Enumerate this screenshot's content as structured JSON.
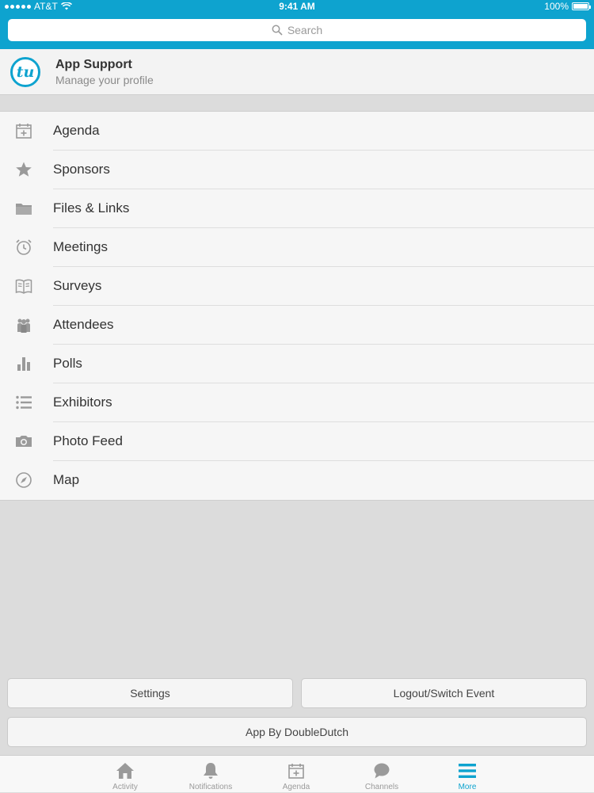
{
  "status_bar": {
    "carrier": "AT&T",
    "time": "9:41 AM",
    "battery": "100%",
    "battery_level": 1.0
  },
  "search": {
    "placeholder": "Search"
  },
  "profile": {
    "logo_text": "tu",
    "name": "App Support",
    "subtitle": "Manage your profile"
  },
  "menu": {
    "items": [
      {
        "label": "Agenda",
        "icon": "calendar-add-icon"
      },
      {
        "label": "Sponsors",
        "icon": "star-icon"
      },
      {
        "label": "Files & Links",
        "icon": "folder-icon"
      },
      {
        "label": "Meetings",
        "icon": "alarm-clock-icon"
      },
      {
        "label": "Surveys",
        "icon": "book-icon"
      },
      {
        "label": "Attendees",
        "icon": "people-icon"
      },
      {
        "label": "Polls",
        "icon": "bar-chart-icon"
      },
      {
        "label": "Exhibitors",
        "icon": "list-icon"
      },
      {
        "label": "Photo Feed",
        "icon": "camera-icon"
      },
      {
        "label": "Map",
        "icon": "compass-icon"
      }
    ]
  },
  "buttons": {
    "settings": "Settings",
    "logout": "Logout/Switch Event",
    "app_by": "App By DoubleDutch"
  },
  "tabbar": {
    "tabs": [
      {
        "label": "Activity",
        "icon": "home-icon"
      },
      {
        "label": "Notifications",
        "icon": "bell-icon"
      },
      {
        "label": "Agenda",
        "icon": "calendar-add-icon"
      },
      {
        "label": "Channels",
        "icon": "chat-bubble-icon"
      },
      {
        "label": "More",
        "icon": "menu-icon",
        "active": true
      }
    ]
  },
  "colors": {
    "accent": "#0ea3cf",
    "icon_gray": "#9a9a9a",
    "text": "#333333"
  }
}
